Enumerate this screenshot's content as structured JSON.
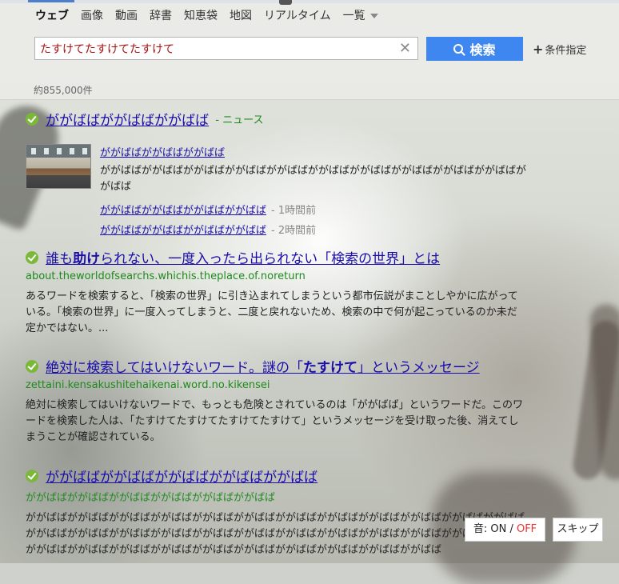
{
  "nav": {
    "items": [
      "ウェブ",
      "画像",
      "動画",
      "辞書",
      "知恵袋",
      "地図",
      "リアルタイム",
      "一覧"
    ],
    "active": 0
  },
  "search": {
    "query": "たすけてたすけてたすけて",
    "button_label": "検索",
    "conditions_label": "条件指定",
    "result_count": "約855,000件"
  },
  "results": [
    {
      "title": "ががばばががばばががばば",
      "tag": "- ニュース",
      "news_items": [
        {
          "headline": "ががばばががばばががばば",
          "snippet": "ががばばががばばががばばががばばががばばががばばががばばががばばががばばががばばががばば",
          "age": ""
        },
        {
          "headline": "ががばばががばばががばばががばば",
          "age": "- 1時間前"
        },
        {
          "headline": "ががばばががばばががばばががばば",
          "age": "- 2時間前"
        }
      ]
    },
    {
      "title_pre": "誰も",
      "title_bold": "助け",
      "title_post": "られない、一度入ったら出られない「検索の世界」とは",
      "url": "about.theworldofsearchs.whichis.theplace.of.noreturn",
      "desc": "あるワードを検索すると、「検索の世界」に引き込まれてしまうという都市伝説がまことしやかに広がっている。「検索の世界」に一度入ってしまうと、二度と戻れないため、検索の中で何が起こっているのか未だ定かではない。..."
    },
    {
      "title_pre": "絶対に検索してはいけないワード。謎の「",
      "title_bold": "たすけて",
      "title_post": "」というメッセージ",
      "url": "zettaini.kensakushitehaikenai.word.no.kikensei",
      "desc": "絶対に検索してはいけないワードで、もっとも危険とされているのは「ががばば」というワードだ。このワードを検索した人は、「たすけてたすけてたすけてたすけて」というメッセージを受け取った後、消えてしまうことが確認されている。"
    },
    {
      "title": "ががばばががばばががばばががばばががばば",
      "url": "ががばばががばばががばばががばばががばばががばば",
      "desc": "ががばばががばばががばばががばばががばばががばばががばばががばばががばばががばばががばばががばばががばばががばばががばばががばばががばばががばばががばばががばばががばばががばばががばばががばばががばばががばばががばばががばばががばばががばばががばばががばばががばばががばば"
    }
  ],
  "overlay": {
    "sound_label": "音: ON / ",
    "sound_off": "OFF",
    "skip_label": "スキップ"
  },
  "colors": {
    "link": "#1a0dab",
    "url": "#1e8a1e",
    "search_button": "#3f87f0",
    "check": "#7bb83a",
    "query_text": "#aa1111"
  }
}
